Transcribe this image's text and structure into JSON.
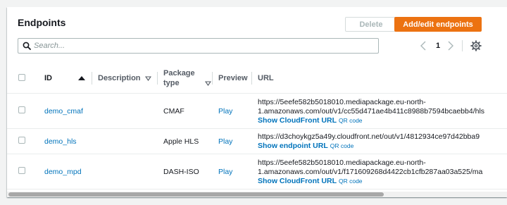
{
  "panel": {
    "title": "Endpoints",
    "delete_label": "Delete",
    "add_label": "Add/edit endpoints"
  },
  "search": {
    "placeholder": "Search..."
  },
  "pagination": {
    "current_page": "1"
  },
  "table": {
    "columns": {
      "id": "ID",
      "description": "Description",
      "package_type_line1": "Package",
      "package_type_line2": "type",
      "preview": "Preview",
      "url": "URL"
    },
    "rows": [
      {
        "id": "demo_cmaf",
        "description": "",
        "package_type": "CMAF",
        "preview": "Play",
        "url_line1": "https://5eefe582b5018010.mediapackage.eu-north-",
        "url_line2": "1.amazonaws.com/out/v1/cc55d471ae4b411c8988b7594bcaebb4/hls",
        "link_label": "Show CloudFront URL",
        "qr_label": "QR code"
      },
      {
        "id": "demo_hls",
        "description": "",
        "package_type": "Apple HLS",
        "preview": "Play",
        "url_line1": "https://d3choykgz5a49y.cloudfront.net/out/v1/4812934ce97d42bba9",
        "link_label": "Show endpoint URL",
        "qr_label": "QR code"
      },
      {
        "id": "demo_mpd",
        "description": "",
        "package_type": "DASH-ISO",
        "preview": "Play",
        "url_line1": "https://5eefe582b5018010.mediapackage.eu-north-",
        "url_line2": "1.amazonaws.com/out/v1/f171609268d4422cb1cfb287aa03a525/ma",
        "link_label": "Show CloudFront URL",
        "qr_label": "QR code"
      }
    ]
  },
  "colors": {
    "accent": "#ec7211",
    "link": "#0073bb",
    "page_bg": "#f2f3f3"
  },
  "icons": [
    "search-icon",
    "chevron-left-icon",
    "chevron-right-icon",
    "gear-icon",
    "sort-ascending-icon",
    "sort-icon"
  ]
}
